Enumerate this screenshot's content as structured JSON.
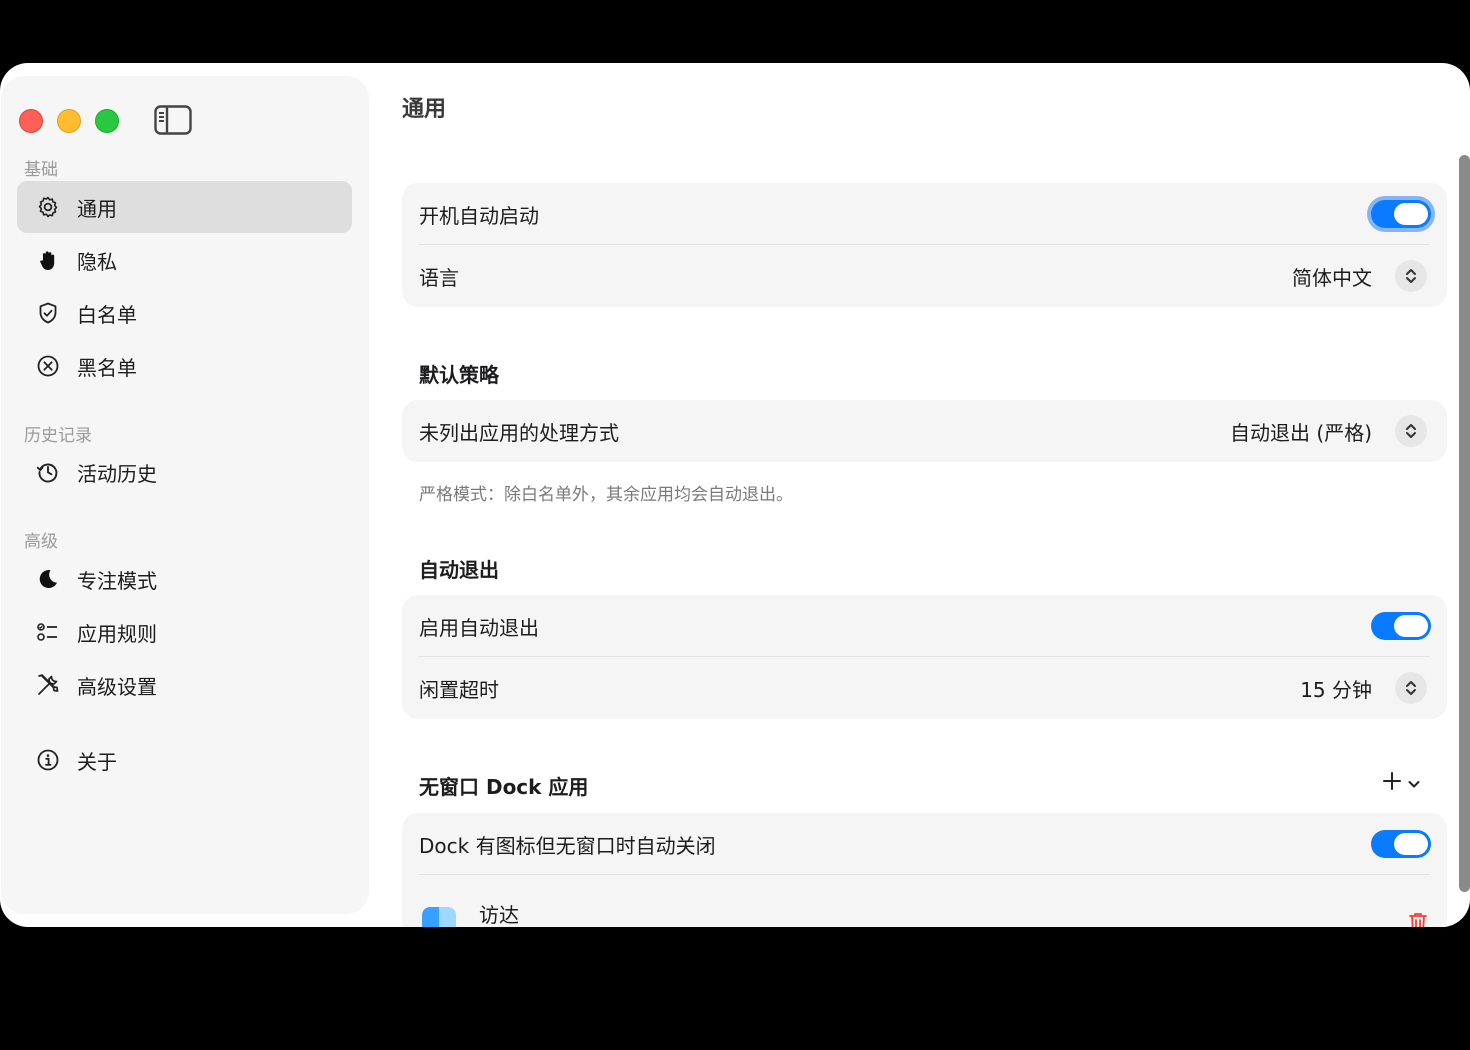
{
  "sidebar": {
    "sections": [
      {
        "label": "基础",
        "items": [
          "通用",
          "隐私",
          "白名单",
          "黑名单"
        ]
      },
      {
        "label": "历史记录",
        "items": [
          "活动历史"
        ]
      },
      {
        "label": "高级",
        "items": [
          "专注模式",
          "应用规则",
          "高级设置"
        ]
      }
    ],
    "about_label": "关于",
    "active_item": "通用"
  },
  "main": {
    "title": "通用",
    "launch_at_login": {
      "label": "开机自动启动",
      "enabled": true
    },
    "language": {
      "label": "语言",
      "value": "简体中文"
    },
    "default_policy": {
      "header": "默认策略",
      "unlisted_label": "未列出应用的处理方式",
      "unlisted_value": "自动退出 (严格)",
      "note": "严格模式：除白名单外，其余应用均会自动退出。"
    },
    "auto_quit": {
      "header": "自动退出",
      "enable_label": "启用自动退出",
      "enabled": true,
      "idle_label": "闲置超时",
      "idle_value": "15 分钟"
    },
    "dock_apps": {
      "header": "无窗口 Dock 应用",
      "close_label": "Dock 有图标但无窗口时自动关闭",
      "enabled": true,
      "apps": [
        "访达"
      ]
    }
  },
  "colors": {
    "accent": "#0a7aff",
    "danger": "#ff3b30"
  }
}
